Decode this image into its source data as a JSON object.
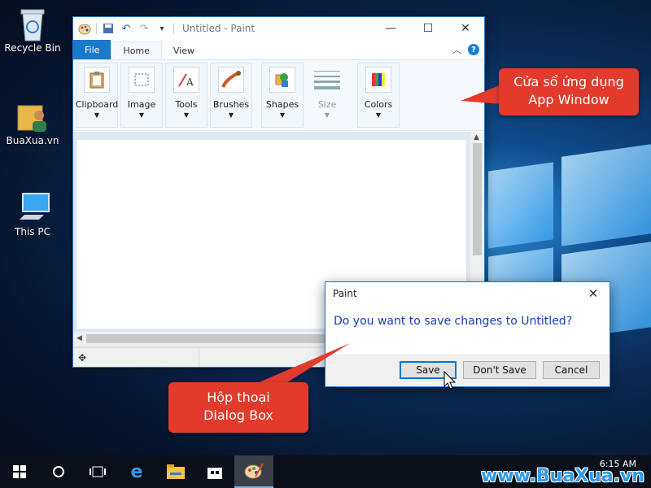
{
  "desktop": {
    "icons": [
      {
        "label": "Recycle Bin",
        "icon": "recycle-bin-icon"
      },
      {
        "label": "BuaXua.vn",
        "icon": "user-folder-icon"
      },
      {
        "label": "This PC",
        "icon": "computer-icon"
      }
    ]
  },
  "paint": {
    "window_title": "Untitled - Paint",
    "tabs": [
      "File",
      "Home",
      "View"
    ],
    "ribbon_groups": [
      {
        "label": "Clipboard",
        "icon": "clipboard-icon"
      },
      {
        "label": "Image",
        "icon": "select-icon"
      },
      {
        "label": "Tools",
        "icon": "tools-icon"
      },
      {
        "label": "Brushes",
        "icon": "brush-icon"
      },
      {
        "label": "Shapes",
        "icon": "shapes-icon"
      },
      {
        "label": "Size",
        "icon": "size-icon"
      },
      {
        "label": "Colors",
        "icon": "palette-icon"
      }
    ]
  },
  "dialog": {
    "title": "Paint",
    "message": "Do you want to save changes to Untitled?",
    "buttons": {
      "save": "Save",
      "dont_save": "Don't Save",
      "cancel": "Cancel"
    }
  },
  "callouts": {
    "app_window_line1": "Cửa sổ ứng dụng",
    "app_window_line2": "App Window",
    "dialog_line1": "Hộp thoại",
    "dialog_line2": "Dialog Box"
  },
  "taskbar": {
    "time": "6:15 AM",
    "watermark": "www.BuaXua.vn"
  },
  "colors": {
    "accent": "#1979ca",
    "callout": "#e23b2c"
  }
}
